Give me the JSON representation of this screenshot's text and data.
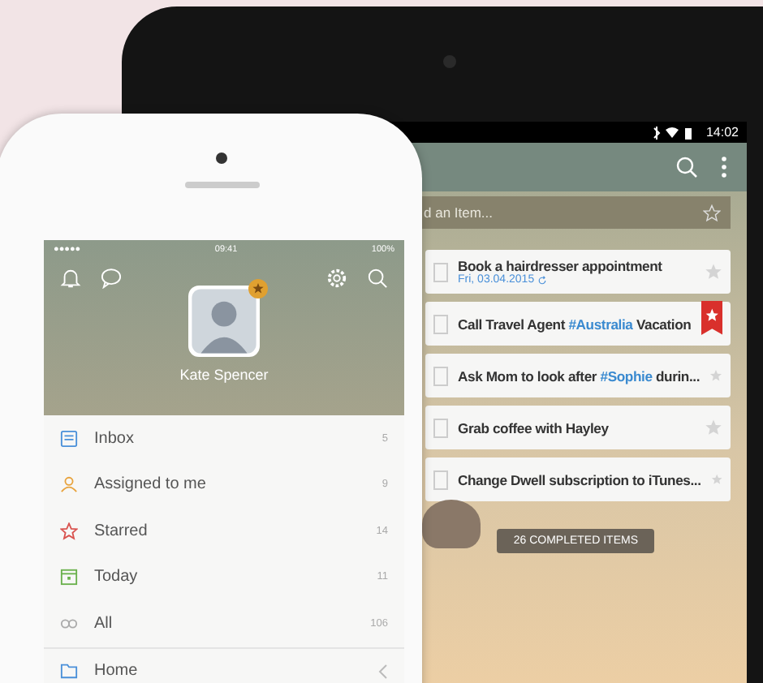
{
  "tablet": {
    "status_bar": {
      "time": "14:02"
    },
    "add_item": {
      "placeholder": "d an Item..."
    },
    "tasks": [
      {
        "parts": [
          {
            "text": "Book a hairdresser appointment",
            "kind": "plain"
          }
        ],
        "due": "Fri, 03.04.2015",
        "checked": false,
        "starred": false
      },
      {
        "parts": [
          {
            "text": "Call Travel Agent ",
            "kind": "plain"
          },
          {
            "text": "#Australia",
            "kind": "hashtag"
          },
          {
            "text": " Vacation",
            "kind": "plain"
          }
        ],
        "checked": false,
        "starred": true
      },
      {
        "parts": [
          {
            "text": "Ask Mom to look after ",
            "kind": "plain"
          },
          {
            "text": "#Sophie",
            "kind": "hashtag"
          },
          {
            "text": " durin...",
            "kind": "plain"
          }
        ],
        "checked": false,
        "starred": false
      },
      {
        "parts": [
          {
            "text": "Grab coffee with Hayley",
            "kind": "plain"
          }
        ],
        "checked": false,
        "starred": false
      },
      {
        "parts": [
          {
            "text": "Change Dwell subscription to iTunes...",
            "kind": "plain"
          }
        ],
        "checked": false,
        "starred": false
      }
    ],
    "completed_button": "26 COMPLETED ITEMS"
  },
  "phone": {
    "status_bar": {
      "signal": "●●●●●",
      "time": "09:41",
      "battery": "100%"
    },
    "user_name": "Kate Spencer",
    "lists": [
      {
        "kind": "inbox",
        "label": "Inbox",
        "count": "5"
      },
      {
        "kind": "assigned",
        "label": "Assigned to me",
        "count": "9"
      },
      {
        "kind": "starred",
        "label": "Starred",
        "count": "14"
      },
      {
        "kind": "today",
        "label": "Today",
        "count": "11"
      },
      {
        "kind": "all",
        "label": "All",
        "count": "106"
      },
      {
        "kind": "folder",
        "label": "Home"
      }
    ]
  }
}
